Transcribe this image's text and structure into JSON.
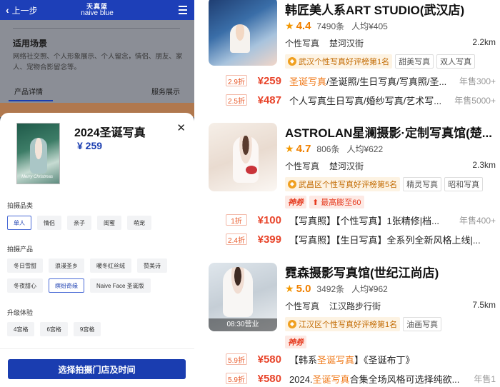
{
  "left": {
    "topbar": {
      "back_label": "上一步",
      "brand_cn": "天真蓝",
      "brand_en": "naive blue"
    },
    "background_page": {
      "section_title": "适用场景",
      "section_text": "网络社交照、个人形象展示、个人留念，情侣、朋友、家人、宠物合影留念等。",
      "tab_details": "产品详情",
      "tab_service": "服务展示"
    },
    "sheet": {
      "poster_script": "Merry Christmas",
      "product_title": "2024圣诞写真",
      "price": "¥ 259",
      "groups": [
        {
          "label": "拍摄品类",
          "options": [
            {
              "text": "单人",
              "selected": true
            },
            {
              "text": "情侣",
              "selected": false
            },
            {
              "text": "亲子",
              "selected": false
            },
            {
              "text": "闺蜜",
              "selected": false
            },
            {
              "text": "萌宠",
              "selected": false
            }
          ]
        },
        {
          "label": "拍摄产品",
          "options": [
            {
              "text": "冬日雪甜",
              "selected": false
            },
            {
              "text": "浪漫圣乡",
              "selected": false
            },
            {
              "text": "暖冬红丝绒",
              "selected": false
            },
            {
              "text": "赞美诗",
              "selected": false
            },
            {
              "text": "冬夜甜心",
              "selected": false
            },
            {
              "text": "缤纷奇缘",
              "selected": true
            },
            {
              "text": "Naive Face 圣诞版",
              "selected": false
            }
          ]
        },
        {
          "label": "升级体验",
          "options": [
            {
              "text": "4宫格",
              "selected": false
            },
            {
              "text": "6宫格",
              "selected": false
            },
            {
              "text": "9宫格",
              "selected": false
            }
          ]
        }
      ],
      "cta": "选择拍摄门店及时间"
    }
  },
  "right": {
    "shops": [
      {
        "name": "韩匠美人系ART STUDIO(武汉店)",
        "score": "4.4",
        "reviews": "7490条",
        "avg": "人均¥405",
        "category": "个性写真",
        "area": "楚河汉街",
        "distance": "2.2km",
        "rank": "武汉个性写真好评榜第1名",
        "chips": [
          "甜美写真",
          "双人写真"
        ],
        "deals": [
          {
            "discount": "2.9折",
            "price": "¥259",
            "desc_hl": "圣诞写真",
            "desc": "/圣诞照/生日写真/写真照/圣...",
            "sold": "年售300+"
          },
          {
            "discount": "2.5折",
            "price": "¥487",
            "desc_hl": "",
            "desc": "个人写真生日写真/婚纱写真/艺术写...",
            "sold": "年售5000+"
          }
        ]
      },
      {
        "name": "ASTROLAN星澜摄影·定制写真馆(楚...",
        "score": "4.7",
        "reviews": "806条",
        "avg": "人均¥622",
        "category": "个性写真",
        "area": "楚河汉街",
        "distance": "2.3km",
        "rank": "武昌区个性写真好评榜第5名",
        "chips": [
          "精灵写真",
          "昭和写真"
        ],
        "shenjia": "神券",
        "max_sub": "最高膨至60",
        "deals": [
          {
            "discount": "1折",
            "price": "¥100",
            "desc_hl": "",
            "desc": "【写真照】【个性写真】1张精修|档...",
            "sold": "年售400+"
          },
          {
            "discount": "2.4折",
            "price": "¥399",
            "desc_hl": "",
            "desc": "【写真照】【生日写真】全系列全新风格上线|...",
            "sold": ""
          }
        ]
      },
      {
        "name": "霓森摄影写真馆(世纪江尚店)",
        "score": "5.0",
        "reviews": "3492条",
        "avg": "人均¥962",
        "category": "个性写真",
        "area": "江汉路步行街",
        "distance": "7.5km",
        "rank": "江汉区个性写真好评榜第1名",
        "chips": [
          "油画写真"
        ],
        "hours": "08:30营业",
        "shenjia": "神券",
        "deals": [
          {
            "discount": "5.9折",
            "price": "¥580",
            "desc_hl": "",
            "desc": "【韩系圣诞写真】《圣诞布丁》",
            "sold": ""
          },
          {
            "discount": "5.9折",
            "price": "¥580",
            "desc_hl": "",
            "desc": "2024.圣诞写真合集全场风格可选择纯欲...",
            "sold": "年售1"
          }
        ]
      }
    ]
  },
  "colors": {
    "brand_blue": "#1a3db0",
    "price_red": "#e8442a",
    "rating_orange": "#f08000",
    "rank_bg": "#fdf3e3"
  }
}
